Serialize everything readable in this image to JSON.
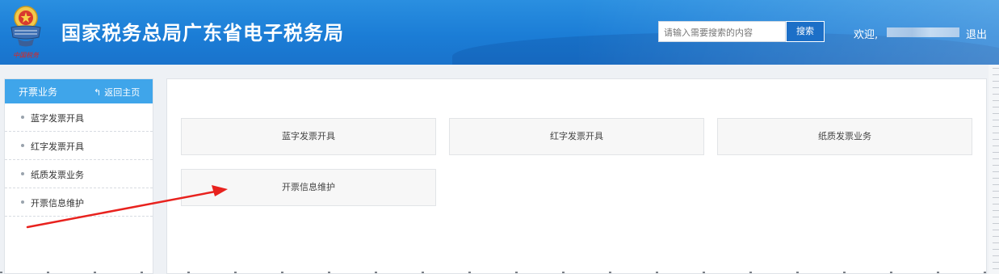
{
  "header": {
    "site_title": "国家税务总局广东省电子税务局",
    "search_placeholder": "请输入需要搜索的内容",
    "search_button": "搜索",
    "welcome": "欢迎,",
    "logout": "退出",
    "emblem_text": "中国税务",
    "colors": {
      "bar": "#1b7dd6",
      "search_button": "#1c6fc7"
    }
  },
  "sidebar": {
    "title": "开票业务",
    "back_label": "返回主页",
    "items": [
      {
        "label": "蓝字发票开具"
      },
      {
        "label": "红字发票开具"
      },
      {
        "label": "纸质发票业务"
      },
      {
        "label": "开票信息维护"
      }
    ],
    "colors": {
      "head": "#3fa5ea"
    }
  },
  "main": {
    "cards": [
      {
        "label": "蓝字发票开具"
      },
      {
        "label": "红字发票开具"
      },
      {
        "label": "纸质发票业务"
      },
      {
        "label": "开票信息维护"
      }
    ]
  },
  "annotation": {
    "color": "#e8221e",
    "icon": "red-arrow-icon"
  }
}
